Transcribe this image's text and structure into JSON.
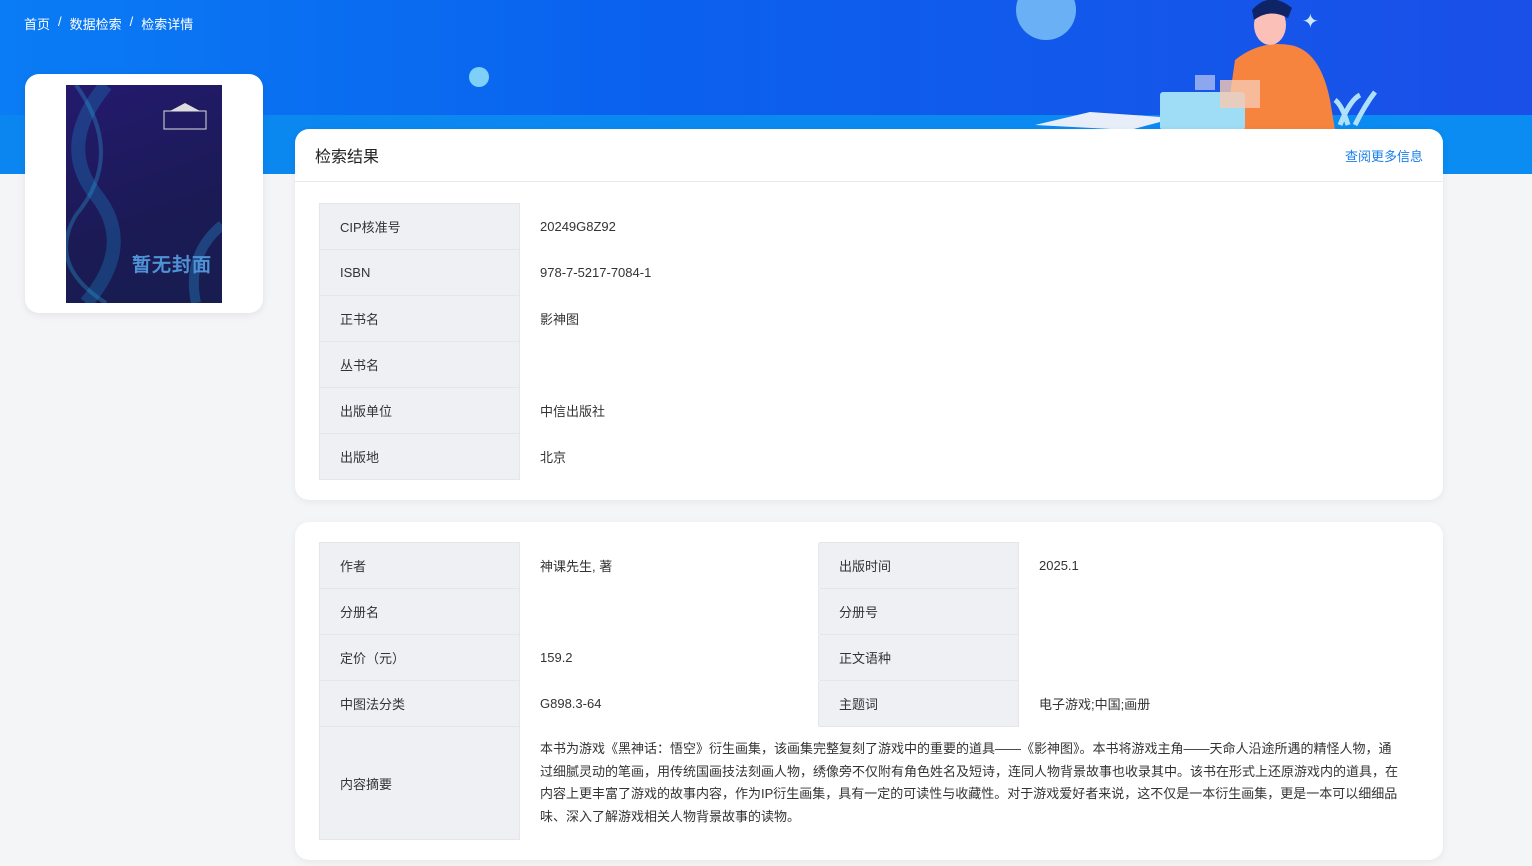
{
  "breadcrumb": [
    "首页",
    "数据检索",
    "检索详情"
  ],
  "cover": {
    "placeholder": "暂无封面"
  },
  "result": {
    "title": "检索结果",
    "more_link": "查阅更多信息",
    "rows": [
      {
        "label": "CIP核准号",
        "value": "20249G8Z92"
      },
      {
        "label": "ISBN",
        "value": "978-7-5217-7084-1"
      },
      {
        "label": "正书名",
        "value": "影神图"
      },
      {
        "label": "丛书名",
        "value": ""
      },
      {
        "label": "出版单位",
        "value": "中信出版社"
      },
      {
        "label": "出版地",
        "value": "北京"
      }
    ]
  },
  "details": {
    "rows": [
      [
        {
          "label": "作者",
          "value": "神课先生, 著"
        },
        {
          "label": "出版时间",
          "value": "2025.1"
        }
      ],
      [
        {
          "label": "分册名",
          "value": ""
        },
        {
          "label": "分册号",
          "value": ""
        }
      ],
      [
        {
          "label": "定价（元）",
          "value": "159.2"
        },
        {
          "label": "正文语种",
          "value": ""
        }
      ],
      [
        {
          "label": "中图法分类",
          "value": "G898.3-64"
        },
        {
          "label": "主题词",
          "value": "电子游戏;中国;画册"
        }
      ]
    ],
    "summary_label": "内容摘要",
    "summary": "本书为游戏《黑神话：悟空》衍生画集，该画集完整复刻了游戏中的重要的道具——《影神图》。本书将游戏主角——天命人沿途所遇的精怪人物，通过细腻灵动的笔画，用传统国画技法刻画人物，绣像旁不仅附有角色姓名及短诗，连同人物背景故事也收录其中。该书在形式上还原游戏内的道具，在内容上更丰富了游戏的故事内容，作为IP衍生画集，具有一定的可读性与收藏性。对于游戏爱好者来说，这不仅是一本衍生画集，更是一本可以细细品味、深入了解游戏相关人物背景故事的读物。"
  }
}
